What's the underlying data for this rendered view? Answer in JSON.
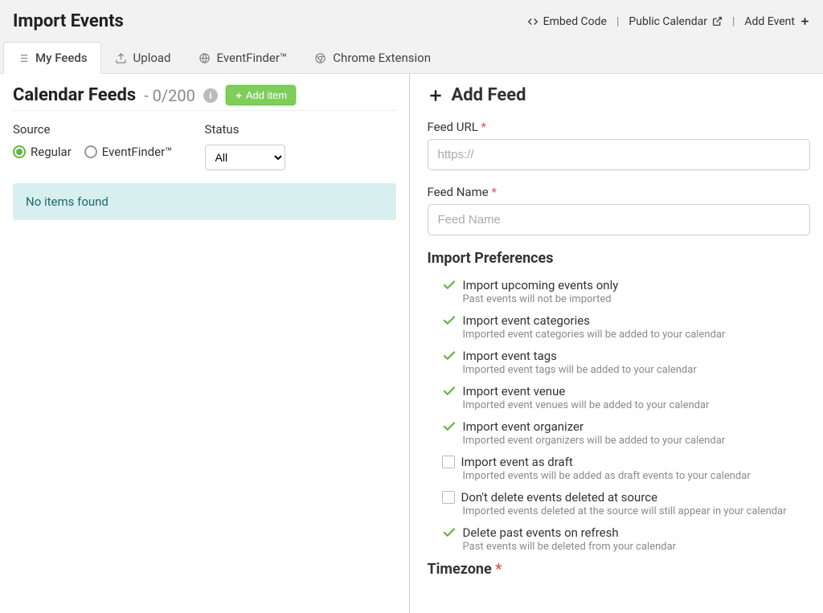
{
  "header": {
    "title": "Import Events",
    "embed_code": "Embed Code",
    "public_calendar": "Public Calendar",
    "add_event": "Add Event"
  },
  "tabs": [
    {
      "label": "My Feeds",
      "icon": "list-icon"
    },
    {
      "label": "Upload",
      "icon": "upload-icon"
    },
    {
      "label": "EventFinder™",
      "icon": "globe-icon"
    },
    {
      "label": "Chrome Extension",
      "icon": "chrome-icon"
    }
  ],
  "left": {
    "heading": "Calendar Feeds",
    "count": "- 0/200",
    "add_label": "Add item",
    "source_label": "Source",
    "status_label": "Status",
    "radio_regular": "Regular",
    "radio_eventfinder": "EventFinder™",
    "select_options": [
      "All"
    ],
    "empty_message": "No items found"
  },
  "right": {
    "heading": "Add Feed",
    "feed_url_label": "Feed URL",
    "feed_url_placeholder": "https://",
    "feed_name_label": "Feed Name",
    "feed_name_placeholder": "Feed Name",
    "prefs_heading": "Import Preferences",
    "prefs": [
      {
        "checked": true,
        "label": "Import upcoming events only",
        "hint": "Past events will not be imported"
      },
      {
        "checked": true,
        "label": "Import event categories",
        "hint": "Imported event categories will be added to your calendar"
      },
      {
        "checked": true,
        "label": "Import event tags",
        "hint": "Imported event tags will be added to your calendar"
      },
      {
        "checked": true,
        "label": "Import event venue",
        "hint": "Imported event venues will be added to your calendar"
      },
      {
        "checked": true,
        "label": "Import event organizer",
        "hint": "Imported event organizers will be added to your calendar"
      },
      {
        "checked": false,
        "label": "Import event as draft",
        "hint": "Imported events will be added as draft events to your calendar"
      },
      {
        "checked": false,
        "label": "Don't delete events deleted at source",
        "hint": "Imported events deleted at the source will still appear in your calendar"
      },
      {
        "checked": true,
        "label": "Delete past events on refresh",
        "hint": "Past events will be deleted from your calendar"
      }
    ],
    "timezone_heading": "Timezone"
  }
}
